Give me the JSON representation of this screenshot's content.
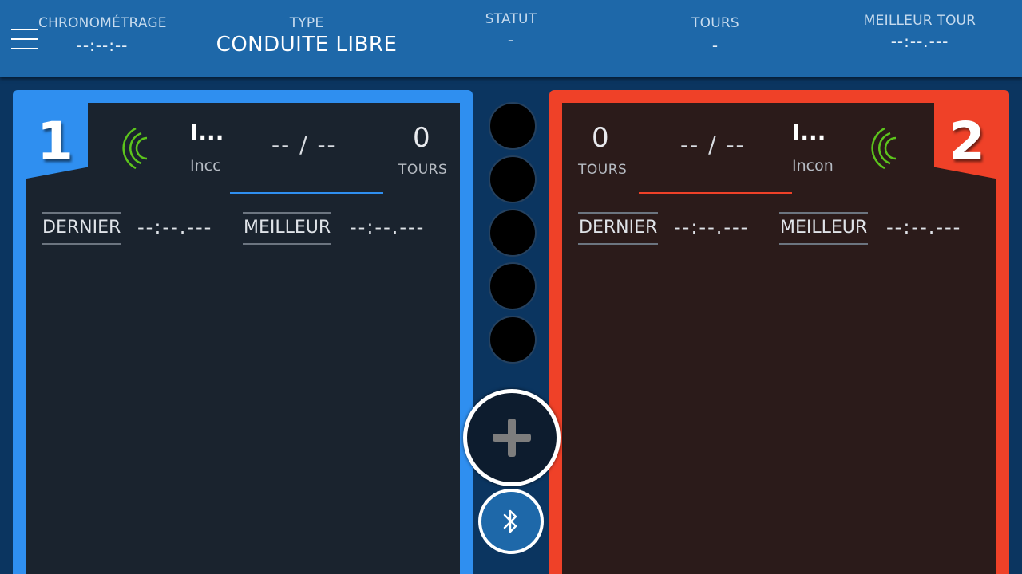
{
  "header": {
    "menu_icon": "hamburger-menu-icon",
    "timing": {
      "label": "CHRONOMÉTRAGE",
      "value": "--:--:--"
    },
    "type": {
      "label": "TYPE",
      "value": "CONDUITE LIBRE"
    },
    "status": {
      "label": "STATUT",
      "value": "-"
    },
    "laps": {
      "label": "TOURS",
      "value": "-"
    },
    "best_lap": {
      "label": "MEILLEUR TOUR",
      "value": "--:--.---"
    }
  },
  "lanes": [
    {
      "number": "1",
      "color": "#2f8ff0",
      "driver_name": "I...",
      "driver_sub": "Incc",
      "position": "-- / --",
      "laps": "0",
      "laps_label": "TOURS",
      "last_label": "DERNIER",
      "last_value": "--:--.---",
      "best_label": "MEILLEUR",
      "best_value": "--:--.---"
    },
    {
      "number": "2",
      "color": "#ef4128",
      "driver_name": "I...",
      "driver_sub": "Incon",
      "position": "-- / --",
      "laps": "0",
      "laps_label": "TOURS",
      "last_label": "DERNIER",
      "last_value": "--:--.---",
      "best_label": "MEILLEUR",
      "best_value": "--:--.---"
    }
  ],
  "center": {
    "lights_count": 5,
    "add_icon": "plus-icon",
    "bluetooth_icon": "bluetooth-icon"
  },
  "colors": {
    "background": "#0b3560",
    "header": "#1e68a9",
    "signal_green": "#5cc41c"
  }
}
